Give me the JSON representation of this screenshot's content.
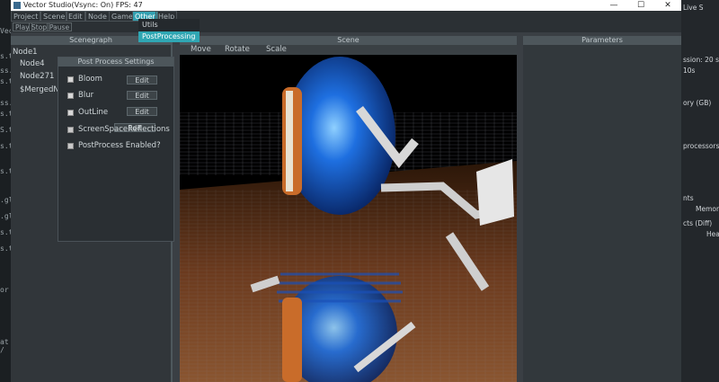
{
  "window": {
    "title": "Vector Studio(Vsync: On) FPS: 47",
    "minimize": "—",
    "maximize": "☐",
    "close": "✕"
  },
  "menus": [
    "Project",
    "Scene",
    "Edit",
    "Node",
    "Game",
    "Other",
    "Help"
  ],
  "toolbar": [
    "Play",
    "Stop",
    "Pause"
  ],
  "other_menu": {
    "items": [
      "Utils",
      "PostProcessing"
    ],
    "highlighted": "PostProcessing"
  },
  "scenegraph": {
    "header": "Scenegraph",
    "nodes": [
      "Node1",
      "Node4",
      "Node271",
      "$MergedN"
    ]
  },
  "postprocess": {
    "header": "Post Process Settings",
    "rows": [
      {
        "label": "Bloom",
        "edit": "Edit"
      },
      {
        "label": "Blur",
        "edit": "Edit"
      },
      {
        "label": "OutLine",
        "edit": "Edit"
      },
      {
        "label": "ScreenSpaceReflections",
        "edit": "Edit"
      },
      {
        "label": "PostProcess Enabled?",
        "edit": ""
      }
    ]
  },
  "scene": {
    "header": "Scene",
    "tools": [
      "Move",
      "Rotate",
      "Scale"
    ]
  },
  "parameters": {
    "header": "Parameters"
  },
  "background_right": [
    "Live S",
    "ssion: 20 seco",
    "10s",
    "ory (GB)",
    "processors)",
    "nts",
    "Memory",
    "cts (Diff)",
    "Hea"
  ],
  "background_left": [
    "Vecto",
    "s.t",
    "ss.",
    "s.t",
    "ss.",
    "s.t",
    "S.t",
    "s.t",
    "s.t",
    ".gl",
    ".gl",
    "s.t",
    "s.t",
    "or",
    "at /"
  ],
  "colors": {
    "accent": "#2fa6b3",
    "panel": "#31363a",
    "header": "#4d565b"
  }
}
